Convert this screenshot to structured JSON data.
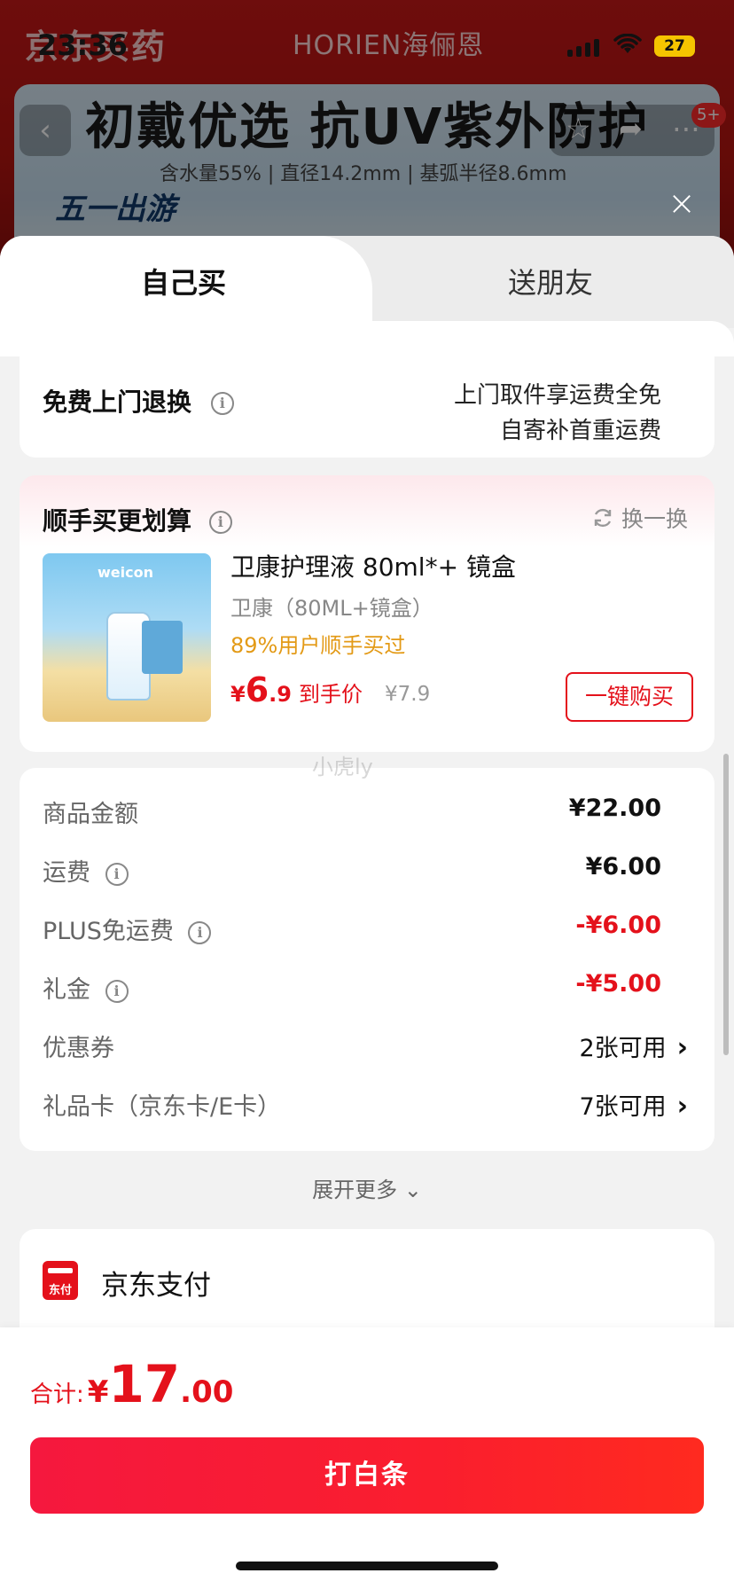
{
  "status_bar": {
    "time": "23:36",
    "battery": "27"
  },
  "background": {
    "brand_left": "京东买药",
    "brand_right": "HORIEN海俪恩",
    "headline": "初戴优选 抗UV紫外防护",
    "specs": "含水量55% | 直径14.2mm | 基弧半径8.6mm",
    "promo": "五一出游",
    "badge": "5+"
  },
  "tabs": [
    {
      "label": "自己买",
      "active": true
    },
    {
      "label": "送朋友",
      "active": false
    }
  ],
  "return_service": {
    "label": "免费上门退换",
    "desc_line1": "上门取件享运费全免",
    "desc_line2": "自寄补首重运费"
  },
  "recommend": {
    "title": "顺手买更划算",
    "refresh_label": "换一换",
    "thumb_brand": "weicon",
    "product": {
      "name": "卫康护理液 80ml*+ 镜盒",
      "sku": "卫康（80ML+镜盒）",
      "social_proof": "89%用户顺手买过",
      "price_symbol": "¥",
      "price_int": "6",
      "price_dec": ".9",
      "price_tag": "到手价",
      "orig_price": "¥7.9"
    },
    "buy_button": "一键购买"
  },
  "watermark": "小虎ly",
  "price_details": {
    "rows": [
      {
        "label": "商品金额",
        "value": "¥22.00",
        "info": false,
        "style": "normal"
      },
      {
        "label": "运费",
        "value": "¥6.00",
        "info": true,
        "style": "normal"
      },
      {
        "label": "PLUS免运费",
        "value": "-¥6.00",
        "info": true,
        "style": "red"
      },
      {
        "label": "礼金",
        "value": "-¥5.00",
        "info": true,
        "style": "red"
      },
      {
        "label": "优惠券",
        "value": "2张可用",
        "info": false,
        "style": "link"
      },
      {
        "label": "礼品卡（京东卡/E卡）",
        "value": "7张可用",
        "info": false,
        "style": "link"
      }
    ],
    "expand_label": "展开更多"
  },
  "payment": {
    "icon_text": "东付",
    "label": "京东支付"
  },
  "footer": {
    "total_label": "合计:",
    "total_symbol": "¥",
    "total_int": "17",
    "total_dec": ".00",
    "pay_button": "打白条"
  },
  "colors": {
    "accent_red": "#e4111b",
    "social_orange": "#e39a16"
  }
}
